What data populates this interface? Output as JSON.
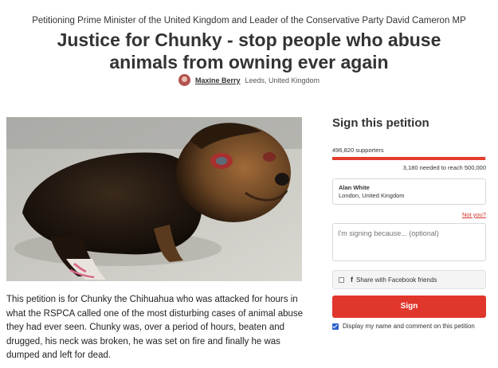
{
  "petition": {
    "target": "Petitioning Prime Minister of the United Kingdom and Leader of the Conservative Party David Cameron MP",
    "title": "Justice for Chunky - stop people who abuse animals from owning ever again",
    "author_name": "Maxine Berry",
    "author_location": "Leeds, United Kingdom",
    "description": "This petition is for Chunky the Chihuahua who was attacked for hours in what the RSPCA called one of the most disturbing cases of animal abuse they had ever seen. Chunky was, over a period of hours, beaten and drugged, his neck was broken, he was set on fire and finally he was dumped and left for dead."
  },
  "sign_panel": {
    "heading": "Sign this petition",
    "supporters": "496,820 supporters",
    "progress_fraction": 0.9936,
    "needed": "3,180 needed to reach 500,000",
    "user_name": "Alan White",
    "user_location": "London, United Kingdom",
    "not_you": "Not you?",
    "comment_placeholder": "I'm signing because... (optional)",
    "facebook_icon": "f",
    "facebook_label": "Share with Facebook friends",
    "sign_button": "Sign",
    "display_label": "Display my name and comment on this petition"
  },
  "colors": {
    "accent": "#e0362b",
    "checkbox": "#2b62c9"
  }
}
